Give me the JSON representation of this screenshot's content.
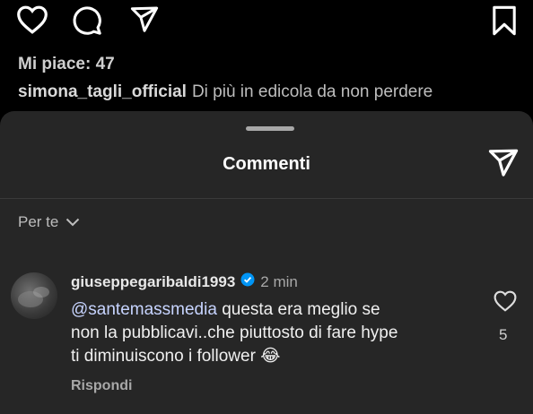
{
  "post": {
    "likes_text": "Mi piace: 47",
    "caption_user": "simona_tagli_official",
    "caption_text": "Di più in edicola da non perdere"
  },
  "comments_sheet": {
    "title": "Commenti",
    "filter_label": "Per te",
    "comments": [
      {
        "username": "giuseppegaribaldi1993",
        "verified": true,
        "time": "2 min",
        "mention": "@santemassmedia",
        "text_line1": " questa era meglio se",
        "text_line2": "non la pubblicavi..che piuttosto di fare hype",
        "text_line3": "ti diminuiscono i follower",
        "emoji": "😂",
        "reply_label": "Rispondi",
        "like_count": "5"
      }
    ]
  },
  "colors": {
    "verified": "#0095f6",
    "sheet_bg": "#262626",
    "background": "#000000"
  },
  "icons": [
    "heart-icon",
    "comment-icon",
    "send-icon",
    "bookmark-icon",
    "chevron-down-icon",
    "verified-icon"
  ]
}
